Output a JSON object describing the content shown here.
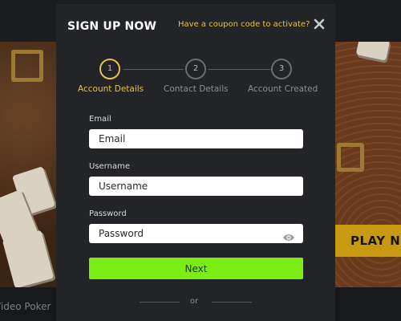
{
  "modal": {
    "title": "SIGN UP NOW",
    "coupon_link": "Have a coupon code to activate?",
    "close_icon": "close-icon"
  },
  "stepper": {
    "steps": [
      {
        "number": "1",
        "label": "Account Details",
        "active": true
      },
      {
        "number": "2",
        "label": "Contact Details",
        "active": false
      },
      {
        "number": "3",
        "label": "Account Created",
        "active": false
      }
    ]
  },
  "form": {
    "email_label": "Email",
    "email_placeholder": "Email",
    "username_label": "Username",
    "username_placeholder": "Username",
    "password_label": "Password",
    "password_placeholder": "Password",
    "password_toggle_icon": "eye-icon",
    "next_label": "Next",
    "or_text": "or"
  },
  "background": {
    "play_button_label": "PLAY N",
    "game_caption": "Video Poker"
  },
  "colors": {
    "accent": "#e8c14a",
    "primary_button": "#7ded16",
    "modal_bg": "#222427"
  }
}
